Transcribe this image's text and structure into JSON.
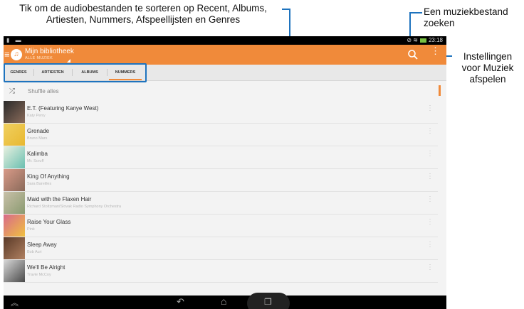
{
  "callouts": {
    "sort": "Tik om de audiobestanden te sorteren op Recent, Albums, Artiesten, Nummers, Afspeellijsten en Genres",
    "search": "Een muziekbestand zoeken",
    "settings": "Instellingen voor Muziek afspelen"
  },
  "statusbar": {
    "left_icons": "▮ ▬",
    "signal": "⊘ ≋",
    "time": "23:18"
  },
  "actionbar": {
    "title": "Mijn bibliotheek",
    "subtitle": "ALLE MUZIEK",
    "menu_icon": "≡",
    "logo_icon": "headphones-icon",
    "search_icon": "search-icon",
    "more_icon": "⋮"
  },
  "tabs": [
    {
      "label": "GENRES",
      "active": false
    },
    {
      "label": "ARTIESTEN",
      "active": false
    },
    {
      "label": "ALBUMS",
      "active": false
    },
    {
      "label": "NUMMERS",
      "active": true
    }
  ],
  "shuffle": {
    "icon": "⤮",
    "label": "Shuffle alles"
  },
  "songs": [
    {
      "title": "E.T. (Featuring Kanye West)",
      "artist": "Katy Perry",
      "colors": [
        "#2a2a2a",
        "#8a6b5a"
      ]
    },
    {
      "title": "Grenade",
      "artist": "Bruno Mars",
      "colors": [
        "#f0d060",
        "#e8b830"
      ]
    },
    {
      "title": "Kalimba",
      "artist": "Mr. Scruff",
      "colors": [
        "#e8f0e0",
        "#6abfb0"
      ]
    },
    {
      "title": "King Of Anything",
      "artist": "Sara Bareilles",
      "colors": [
        "#d89a88",
        "#8a6a5a"
      ]
    },
    {
      "title": "Maid with the Flaxen Hair",
      "artist": "Richard Stoltzman/Slovak Radio Symphony Orchestra",
      "colors": [
        "#c8c0a8",
        "#8a9a70"
      ]
    },
    {
      "title": "Raise Your Glass",
      "artist": "Pink",
      "colors": [
        "#d86a8a",
        "#f0c040"
      ]
    },
    {
      "title": "Sleep Away",
      "artist": "Bob Acri",
      "colors": [
        "#5a3a28",
        "#b08060"
      ]
    },
    {
      "title": "We'll Be Alright",
      "artist": "Travie McCoy",
      "colors": [
        "#d8d8d8",
        "#4a4a4a"
      ]
    }
  ],
  "row_more_icon": "⋮",
  "navbar": {
    "hide": "︽",
    "back": "↶",
    "home": "⌂",
    "recent": "❐"
  }
}
